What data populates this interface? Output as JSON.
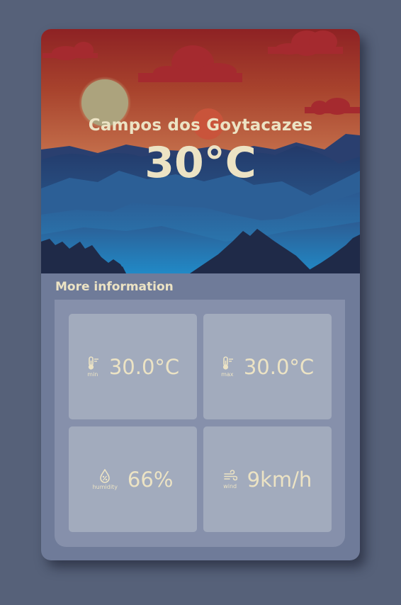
{
  "weather": {
    "city": "Campos dos Goytacazes",
    "temperature": "30°C"
  },
  "more_info": {
    "title": "More information",
    "min": {
      "icon": "thermometer-icon",
      "caption": "min",
      "value": "30.0°C"
    },
    "max": {
      "icon": "thermometer-icon",
      "caption": "max",
      "value": "30.0°C"
    },
    "humidity": {
      "icon": "humidity-drop-icon",
      "caption": "humidity",
      "value": "66%"
    },
    "wind": {
      "icon": "wind-icon",
      "caption": "wind",
      "value": "9km/h"
    }
  },
  "colors": {
    "page_background": "#566179",
    "card_background": "#6f7b99",
    "panel_background": "#8690ab",
    "tile_background": "#a2abbd",
    "text_cream": "#ece3c4"
  }
}
